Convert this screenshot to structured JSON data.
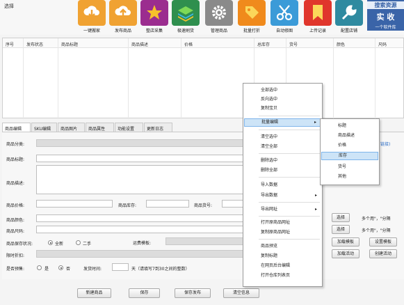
{
  "app": {
    "label": "选择"
  },
  "toolbar": {
    "items": [
      {
        "label": "一键搬家",
        "icon": "download-cloud-icon",
        "color": "#f0a232"
      },
      {
        "label": "发布商品",
        "icon": "upload-cloud-icon",
        "color": "#f0a232"
      },
      {
        "label": "整店采集",
        "icon": "star-icon",
        "color": "#9b2d8f"
      },
      {
        "label": "极速刷货",
        "icon": "layers-icon",
        "color": "#2f8f4e"
      },
      {
        "label": "管理商品",
        "icon": "gear-icon",
        "color": "#8a8a8a"
      },
      {
        "label": "批量打折",
        "icon": "price-tag-icon",
        "color": "#f08a1c"
      },
      {
        "label": "自动修图",
        "icon": "scissors-icon",
        "color": "#3b9bd8"
      },
      {
        "label": "上传记录",
        "icon": "bookmark-icon",
        "color": "#e0362c"
      },
      {
        "label": "配置店铺",
        "icon": "wrench-icon",
        "color": "#2f8aa0"
      }
    ],
    "promo": {
      "line1": "搜索资源",
      "line2": "实 收",
      "line3": "一个软件库"
    }
  },
  "grid": {
    "columns": [
      "序号",
      "发布状态",
      "商品标题",
      "商品描述",
      "价格",
      "总库存",
      "货号",
      "颜色",
      "尺码"
    ]
  },
  "tabs": [
    "商品编辑",
    "SKU编辑",
    "商品图片",
    "商品属性",
    "功能设置",
    "更新日志"
  ],
  "editor": {
    "category_label": "商品分类:",
    "title_label": "商品标题:",
    "desc_label": "商品描述:",
    "price_label": "商品价格:",
    "stock_label": "商品库存:",
    "sku_label": "商品货号:",
    "color_label": "商品颜色:",
    "size_label": "商品尺码:",
    "condition_label": "商品保存状况:",
    "cond_new": "全新",
    "cond_used": "二手",
    "shipping_label": "运费模板:",
    "discount_label": "限时折扣:",
    "presale_label": "是否预售:",
    "presale_yes": "是",
    "presale_no": "否",
    "ship_time_label": "发货时间:",
    "ship_time_note": "天（请填写7到30之间的整数）",
    "link_hint": "链接)",
    "select_btn_1": "选择",
    "select_btn_2": "选择",
    "multi_hint_1": "多个用\"，\"分隔",
    "multi_hint_2": "多个用\"，\"分隔",
    "load_template_btn": "加载模板",
    "set_template_btn": "设置模板",
    "load_activity_btn": "加载活动",
    "create_activity_btn": "创建活动"
  },
  "bottom": {
    "new_btn": "新建商品",
    "save_btn": "保存",
    "save_publish_btn": "保存发布",
    "clear_btn": "清空信息"
  },
  "context_menu": {
    "items": [
      "全部选中",
      "反向选中",
      "复制宝贝",
      "批量编辑",
      "清空选中",
      "清空全部",
      "删除选中",
      "删除全部",
      "导入数据",
      "导出数据",
      "导出网址",
      "打开原商品网址",
      "复制原商品网址",
      "商品预览",
      "复制标题",
      "在网页后台编辑",
      "打开仓库列表页"
    ],
    "highlighted": "批量编辑",
    "submenu": {
      "items": [
        "标题",
        "商品描述",
        "价格",
        "库存",
        "货号",
        "其他"
      ],
      "highlighted": "库存"
    }
  }
}
